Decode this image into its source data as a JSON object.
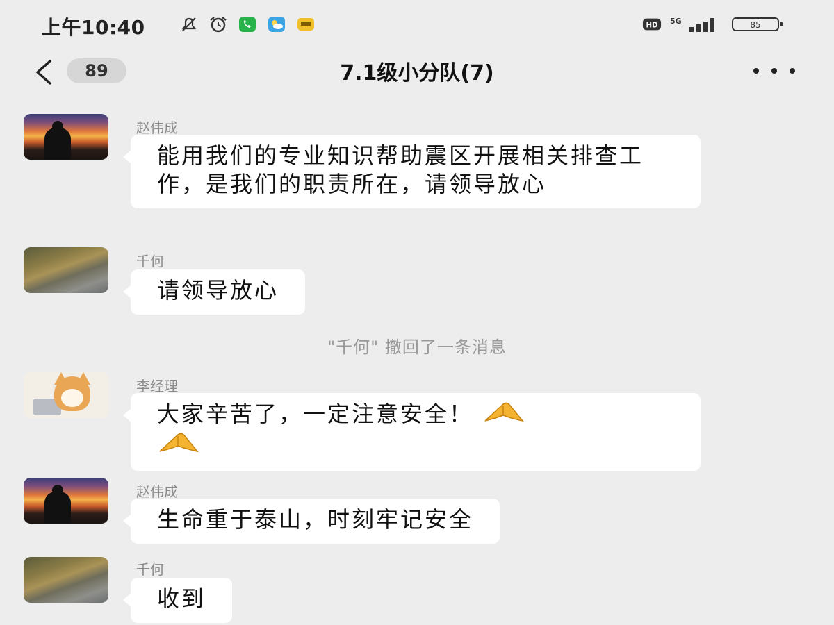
{
  "status_bar": {
    "time": "上午10:40",
    "network": "5G",
    "battery": "85"
  },
  "header": {
    "unread_count": "89",
    "title": "7.1级小分队(7)"
  },
  "messages": [
    {
      "sender": "赵伟成",
      "text": "能用我们的专业知识帮助震区开展相关排查工作，是我们的职责所在，请领导放心",
      "avatar": "sunset-avatar"
    },
    {
      "sender": "千何",
      "text": "请领导放心",
      "avatar": "rock-avatar"
    },
    {
      "system": "\"千何\" 撤回了一条消息"
    },
    {
      "sender": "李经理",
      "text": "大家辛苦了，一定注意安全！",
      "avatar": "cat-avatar",
      "emoji": "folded-hands-icon"
    },
    {
      "sender": "赵伟成",
      "text": "生命重于泰山，时刻牢记安全",
      "avatar": "sunset-avatar"
    },
    {
      "sender": "千何",
      "text": "收到",
      "avatar": "rock-avatar"
    }
  ]
}
